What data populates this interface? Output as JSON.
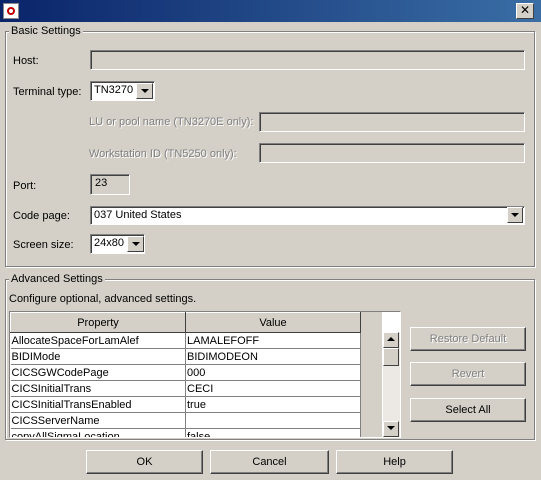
{
  "window": {
    "close_glyph": "✕"
  },
  "basic": {
    "title": "Basic Settings",
    "host_label": "Host:",
    "host_value": "",
    "terminal_type_label": "Terminal type:",
    "terminal_type_value": "TN3270",
    "lu_label": "LU or pool name (TN3270E only):",
    "lu_value": "",
    "workstation_label": "Workstation ID (TN5250 only):",
    "workstation_value": "",
    "port_label": "Port:",
    "port_value": "23",
    "code_page_label": "Code page:",
    "code_page_value": "037 United States",
    "screen_size_label": "Screen size:",
    "screen_size_value": "24x80"
  },
  "advanced": {
    "title": "Advanced Settings",
    "description": "Configure optional, advanced settings.",
    "columns": [
      "Property",
      "Value"
    ],
    "rows": [
      [
        "AllocateSpaceForLamAlef",
        "LAMALEFOFF"
      ],
      [
        "BIDIMode",
        "BIDIMODEON"
      ],
      [
        "CICSGWCodePage",
        "000"
      ],
      [
        "CICSInitialTrans",
        "CECI"
      ],
      [
        "CICSInitialTransEnabled",
        "true"
      ],
      [
        "CICSServerName",
        ""
      ],
      [
        "copyAllSigmaLocation",
        "false"
      ]
    ],
    "restore_default_label": "Restore Default",
    "revert_label": "Revert",
    "select_all_label": "Select All"
  },
  "footer": {
    "ok_label": "OK",
    "cancel_label": "Cancel",
    "help_label": "Help"
  }
}
